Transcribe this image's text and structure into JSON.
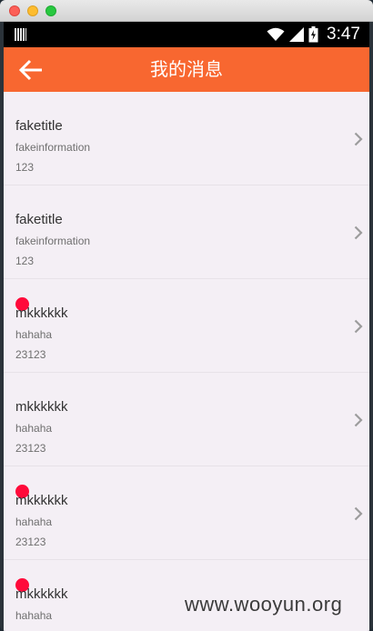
{
  "status_bar": {
    "time": "3:47",
    "icons": [
      "sim-card-icon",
      "wifi-icon",
      "signal-icon",
      "battery-icon"
    ]
  },
  "app_bar": {
    "title": "我的消息",
    "back_icon": "arrow-left-icon",
    "color": "#f86730"
  },
  "messages": [
    {
      "title": "faketitle",
      "info": "fakeinformation",
      "number": "123",
      "unread": false
    },
    {
      "title": "faketitle",
      "info": "fakeinformation",
      "number": "123",
      "unread": false
    },
    {
      "title": "mkkkkkk",
      "info": "hahaha",
      "number": "23123",
      "unread": true
    },
    {
      "title": "mkkkkkk",
      "info": "hahaha",
      "number": "23123",
      "unread": false
    },
    {
      "title": "mkkkkkk",
      "info": "hahaha",
      "number": "23123",
      "unread": true
    },
    {
      "title": "mkkkkkk",
      "info": "hahaha",
      "number": "",
      "unread": true
    }
  ],
  "unread_color": "#ff0a3a",
  "watermark": "www.wooyun.org"
}
